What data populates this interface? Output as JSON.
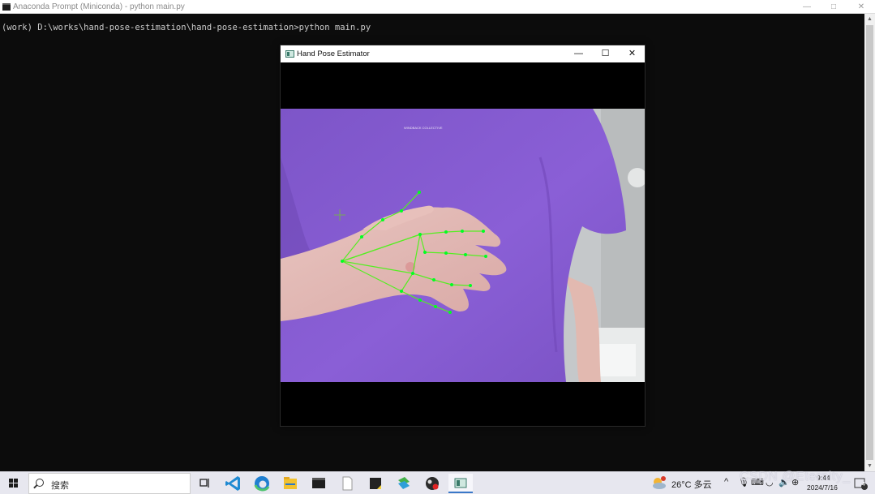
{
  "console": {
    "title": "Anaconda Prompt (Miniconda) - python  main.py",
    "minimize_glyph": "—",
    "maximize_glyph": "□",
    "close_glyph": "✕",
    "command_line": "(work) D:\\works\\hand-pose-estimation\\hand-pose-estimation>python main.py"
  },
  "cv_window": {
    "title": "Hand Pose Estimator",
    "minimize_glyph": "—",
    "maximize_glyph": "☐",
    "close_glyph": "✕",
    "shirt_print": "WINDBACK COLLECTIVE",
    "keypoint_color": "#00ff22",
    "bone_color": "#55ee22",
    "shirt_color": "#8a5fd6",
    "wall_color": "#c9cbcc"
  },
  "taskbar": {
    "search_placeholder": "搜索",
    "apps": [
      "task-view",
      "vscode",
      "edge",
      "file-explorer",
      "terminal",
      "notepad",
      "sticky-notes",
      "anaconda",
      "obs",
      "opencv-window"
    ],
    "weather": "26°C 多云",
    "time": "9:44",
    "date": "2024/7/16",
    "notification_count": "4"
  },
  "watermark": "CSDN @Eternity_"
}
